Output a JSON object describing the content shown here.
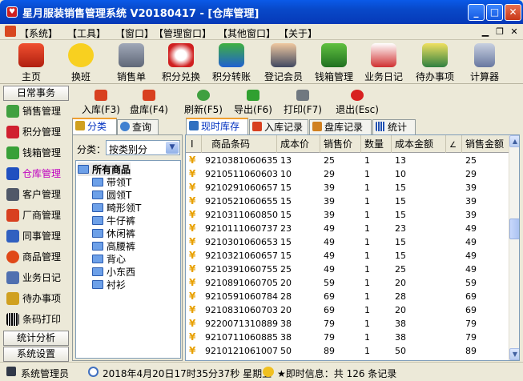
{
  "window": {
    "title": "星月服装销售管理系统  V20180417 - [仓库管理]",
    "colors": {
      "titlebar": "#0a5ae8",
      "accent_nav": "#c000c0"
    }
  },
  "menu": [
    "【系统】",
    "【工具】",
    "【窗口】",
    "【管理窗口】",
    "【其他窗口】",
    "【关于】"
  ],
  "toolbar": [
    "主页",
    "换班",
    "销售单",
    "积分兑换",
    "积分转账",
    "登记会员",
    "钱箱管理",
    "业务日记",
    "待办事项",
    "计算器"
  ],
  "nav": {
    "group1": "日常事务",
    "items": [
      "销售管理",
      "积分管理",
      "钱箱管理",
      "仓库管理",
      "客户管理",
      "厂商管理",
      "同事管理",
      "商品管理",
      "业务日记",
      "待办事项",
      "条码打印"
    ],
    "active_index": 3,
    "group2": "统计分析",
    "group3": "系统设置"
  },
  "subtoolbar": [
    "入库(F3)",
    "盘库(F4)",
    "刷新(F5)",
    "导出(F6)",
    "打印(F7)",
    "退出(Esc)"
  ],
  "left_tabs": [
    "分类",
    "查询"
  ],
  "classify": {
    "label": "分类：",
    "value": "按类别分"
  },
  "tree": {
    "root": "所有商品",
    "children": [
      "带领T",
      "圆领T",
      "畸形领T",
      "牛仔裤",
      "休闲裤",
      "高腰裤",
      "背心",
      "小东西",
      "衬衫"
    ]
  },
  "grid_tabs": [
    "现时库存",
    "入库记录",
    "盘库记录",
    "统计"
  ],
  "columns": [
    "I",
    "商品条码",
    "成本价",
    "销售价",
    "数量",
    "成本金额",
    "∠",
    "销售金额"
  ],
  "rows": [
    [
      "¥",
      "9210381060635",
      "13",
      "25",
      "1",
      "13",
      "",
      "25"
    ],
    [
      "¥",
      "9210511060603",
      "10",
      "29",
      "1",
      "10",
      "",
      "29"
    ],
    [
      "¥",
      "9210291060657",
      "15",
      "39",
      "1",
      "15",
      "",
      "39"
    ],
    [
      "¥",
      "9210521060655",
      "15",
      "39",
      "1",
      "15",
      "",
      "39"
    ],
    [
      "¥",
      "9210311060850",
      "15",
      "39",
      "1",
      "15",
      "",
      "39"
    ],
    [
      "¥",
      "9210111060737",
      "23",
      "49",
      "1",
      "23",
      "",
      "49"
    ],
    [
      "¥",
      "9210301060653",
      "15",
      "49",
      "1",
      "15",
      "",
      "49"
    ],
    [
      "¥",
      "9210321060657",
      "15",
      "49",
      "1",
      "15",
      "",
      "49"
    ],
    [
      "¥",
      "9210391060755",
      "25",
      "49",
      "1",
      "25",
      "",
      "49"
    ],
    [
      "¥",
      "9210891060705",
      "20",
      "59",
      "1",
      "20",
      "",
      "59"
    ],
    [
      "¥",
      "9210591060784",
      "28",
      "69",
      "1",
      "28",
      "",
      "69"
    ],
    [
      "¥",
      "9210831060703",
      "20",
      "69",
      "1",
      "20",
      "",
      "69"
    ],
    [
      "¥",
      "9220071310889",
      "38",
      "79",
      "1",
      "38",
      "",
      "79"
    ],
    [
      "¥",
      "9210711060885",
      "38",
      "79",
      "1",
      "38",
      "",
      "79"
    ],
    [
      "¥",
      "9210121061007",
      "50",
      "89",
      "1",
      "50",
      "",
      "89"
    ]
  ],
  "status": {
    "user": "系统管理员",
    "datetime": "2018年4月20日17时35分37秒  星期五",
    "info": "★即时信息：共 126 条记录"
  }
}
